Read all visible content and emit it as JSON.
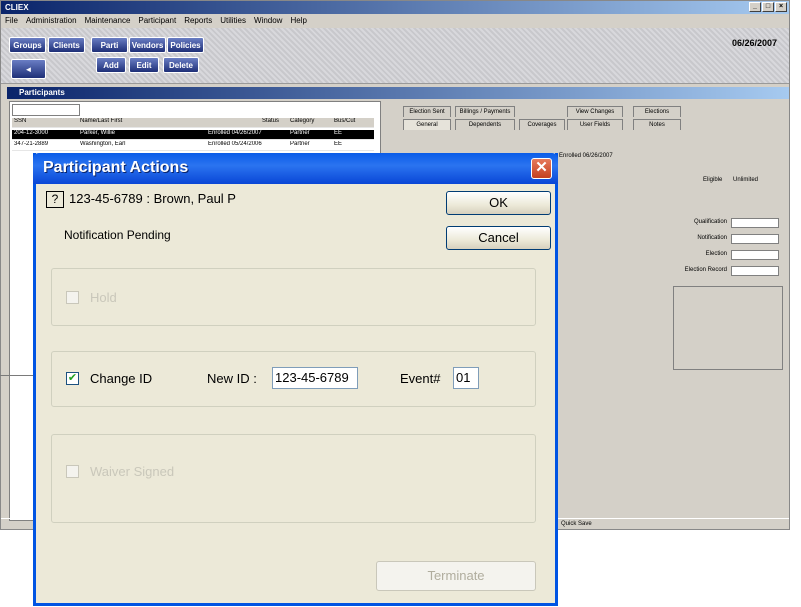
{
  "app": {
    "title": "CLIEX",
    "date": "06/26/2007",
    "menu": [
      "File",
      "Administration",
      "Maintenance",
      "Participant",
      "Reports",
      "Utilities",
      "Window",
      "Help"
    ],
    "toolbar_buttons": [
      "Add",
      "Edit",
      "Delete"
    ],
    "nav_buttons": [
      "Groups",
      "Clients",
      "Parti",
      "Vendors",
      "Policies"
    ],
    "participants_title": "Participants",
    "list": {
      "headers": [
        "SSN",
        "Name/Last First",
        "Status",
        "Category",
        "Bus/Cut"
      ],
      "rows": [
        [
          "204-12-3000",
          "Parker, Willie",
          "Enrolled 04/26/2007",
          "Partner",
          "EE"
        ],
        [
          "347-21-2889",
          "Washington, Earl",
          "Enrolled 05/24/2006",
          "Partner",
          "EE"
        ]
      ]
    },
    "tabs_row1": [
      "Election Sent",
      "Billings / Payments",
      "View Changes",
      "Elections"
    ],
    "tabs_row2": [
      "General",
      "Dependents",
      "Coverages",
      "User Fields",
      "Notes"
    ],
    "enrolled_text": "Enrolled 06/26/2007",
    "eligible_label": "Eligible",
    "unlimited_label": "Unlimited",
    "date_labels": [
      "Qualification",
      "Notification",
      "Election",
      "Election Record"
    ],
    "status_right": "Quick Save"
  },
  "dialog": {
    "title": "Participant Actions",
    "help_label": "?",
    "ssn": "123-45-6789",
    "separator": ":",
    "name": "Brown,  Paul P",
    "notification": "Notification Pending",
    "ok_label": "OK",
    "cancel_label": "Cancel",
    "hold_label": "Hold",
    "change_id_label": "Change ID",
    "new_id_label": "New ID :",
    "new_id_value": "123-45-6789",
    "event_label": "Event#",
    "event_value": "01",
    "waiver_label": "Waiver Signed",
    "terminate_label": "Terminate",
    "change_id_checked": true,
    "hold_checked": false,
    "waiver_checked": false
  }
}
